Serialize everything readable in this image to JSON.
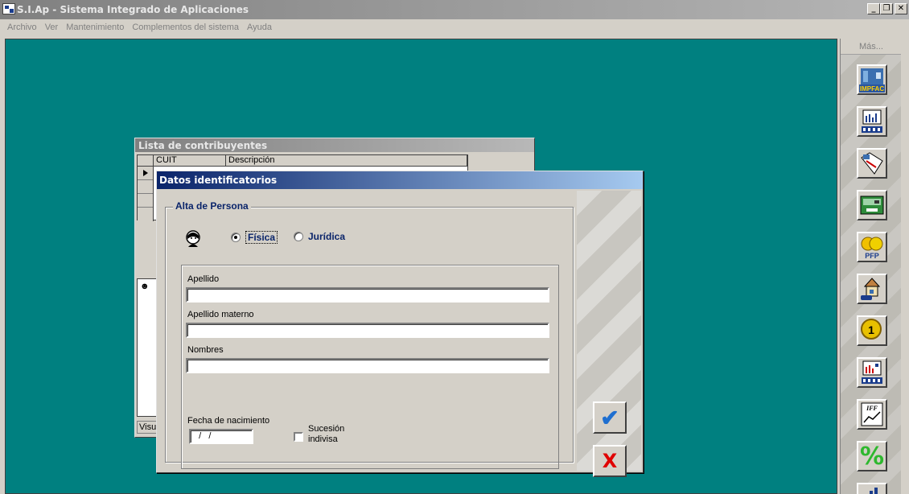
{
  "window": {
    "title": "S.I.Ap - Sistema Integrado de Aplicaciones",
    "minimize_glyph": "_",
    "restore_glyph": "❐",
    "close_glyph": "✕"
  },
  "menu": {
    "items": [
      "Archivo",
      "Ver",
      "Mantenimiento",
      "Complementos del sistema",
      "Ayuda"
    ]
  },
  "toolbar": {
    "more_label": "Más...",
    "buttons": [
      {
        "icon": "impfac-icon",
        "text": "IMPFAC"
      },
      {
        "icon": "chart-people-icon",
        "text": ""
      },
      {
        "icon": "map-icon",
        "text": ""
      },
      {
        "icon": "cash-register-icon",
        "text": ""
      },
      {
        "icon": "pfp-icon",
        "text": "PFP"
      },
      {
        "icon": "house-car-icon",
        "text": ""
      },
      {
        "icon": "coin-icon",
        "text": ""
      },
      {
        "icon": "chart-people-6-icon",
        "text": ""
      },
      {
        "icon": "iff-chart-icon",
        "text": "IFF"
      },
      {
        "icon": "percent-icon",
        "text": "%"
      },
      {
        "icon": "bar-chart-icon",
        "text": ""
      }
    ]
  },
  "lista": {
    "title": "Lista de contribuyentes",
    "columns": [
      "CUIT",
      "Descripción"
    ],
    "status_label": "Visu"
  },
  "dialog": {
    "title": "Datos identificatorios",
    "group_label": "Alta de Persona",
    "radio_fisica": "Física",
    "radio_juridica": "Jurídica",
    "selected": "Física",
    "fields": {
      "apellido_label": "Apellido",
      "apellido_value": "",
      "apellido_materno_label": "Apellido materno",
      "apellido_materno_value": "",
      "nombres_label": "Nombres",
      "nombres_value": "",
      "fecha_label": "Fecha de nacimiento",
      "fecha_value": "  /   /",
      "sucesion_label_1": "Sucesión",
      "sucesion_label_2": "indivisa",
      "sucesion_checked": false
    },
    "ok_glyph": "✔",
    "cancel_glyph": "X"
  },
  "colors": {
    "desktop": "#008080",
    "dialog_title": "#0a246a",
    "ok": "#1f6fd0",
    "cancel": "#e00000"
  }
}
